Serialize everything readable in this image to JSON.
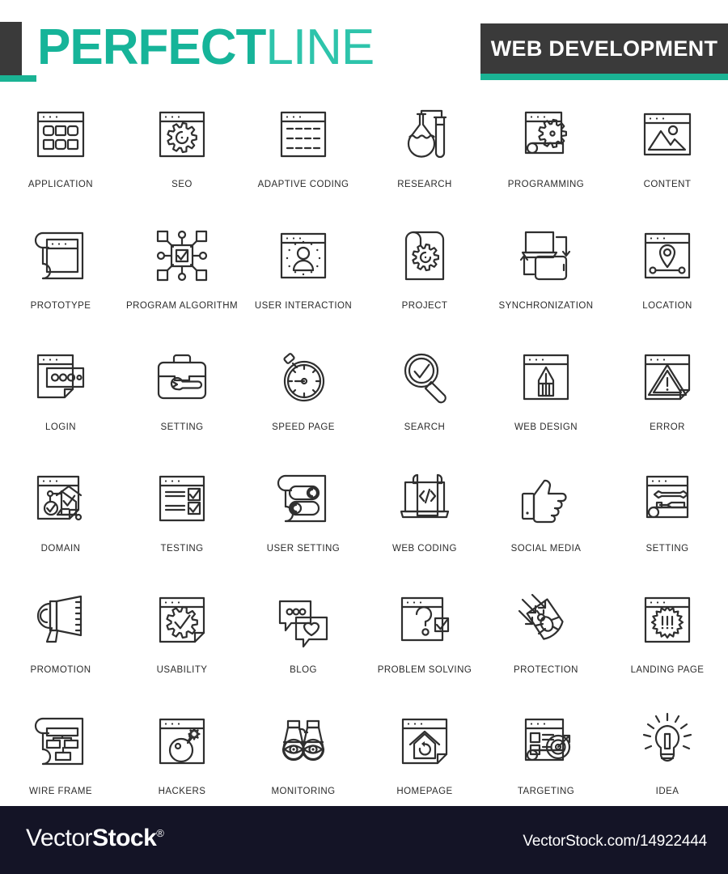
{
  "header": {
    "brand_bold": "PERFECT",
    "brand_light": "LINE",
    "badge_label": "WEB DEVELOPMENT",
    "accent_color": "#1ab394",
    "dark_color": "#3a3a3a"
  },
  "icons": [
    {
      "label": "APPLICATION",
      "icon": "browser-grid-icon"
    },
    {
      "label": "SEO",
      "icon": "browser-gear-icon"
    },
    {
      "label": "ADAPTIVE CODING",
      "icon": "browser-dashed-lines-icon"
    },
    {
      "label": "RESEARCH",
      "icon": "flask-test-tube-icon"
    },
    {
      "label": "PROGRAMMING",
      "icon": "page-gear-icon"
    },
    {
      "label": "CONTENT",
      "icon": "browser-image-icon"
    },
    {
      "label": "PROTOTYPE",
      "icon": "blueprint-roll-browser-icon"
    },
    {
      "label": "PROGRAM ALGORITHM",
      "icon": "chip-network-check-icon"
    },
    {
      "label": "USER INTERACTION",
      "icon": "browser-user-dots-icon"
    },
    {
      "label": "PROJECT",
      "icon": "scroll-gear-icon"
    },
    {
      "label": "SYNCHRONIZATION",
      "icon": "laptop-phone-sync-icon"
    },
    {
      "label": "LOCATION",
      "icon": "browser-map-pin-icon"
    },
    {
      "label": "LOGIN",
      "icon": "page-password-dots-icon"
    },
    {
      "label": "SETTING",
      "icon": "toolbox-wrench-icon"
    },
    {
      "label": "SPEED PAGE",
      "icon": "stopwatch-icon"
    },
    {
      "label": "SEARCH",
      "icon": "magnifier-check-icon"
    },
    {
      "label": "WEB DESIGN",
      "icon": "browser-pencil-icon"
    },
    {
      "label": "ERROR",
      "icon": "browser-warning-triangle-icon"
    },
    {
      "label": "DOMAIN",
      "icon": "browser-house-check-nodes-icon"
    },
    {
      "label": "TESTING",
      "icon": "browser-checklist-icon"
    },
    {
      "label": "USER SETTING",
      "icon": "scroll-toggles-icon"
    },
    {
      "label": "WEB CODING",
      "icon": "laptop-code-scroll-icon"
    },
    {
      "label": "SOCIAL MEDIA",
      "icon": "thumbs-up-icon"
    },
    {
      "label": "SETTING",
      "icon": "page-wrench-screwdriver-icon"
    },
    {
      "label": "PROMOTION",
      "icon": "megaphone-icon"
    },
    {
      "label": "USABILITY",
      "icon": "browser-gear-check-icon"
    },
    {
      "label": "BLOG",
      "icon": "chat-bubbles-heart-icon"
    },
    {
      "label": "PROBLEM SOLVING",
      "icon": "browser-question-check-icon"
    },
    {
      "label": "PROTECTION",
      "icon": "shield-bug-arrows-icon"
    },
    {
      "label": "LANDING PAGE",
      "icon": "browser-starburst-icon"
    },
    {
      "label": "WIRE FRAME",
      "icon": "blueprint-roll-sitemap-icon"
    },
    {
      "label": "HACKERS",
      "icon": "browser-bomb-icon"
    },
    {
      "label": "MONITORING",
      "icon": "binoculars-eyes-icon"
    },
    {
      "label": "HOMEPAGE",
      "icon": "browser-house-refresh-icon"
    },
    {
      "label": "TARGETING",
      "icon": "page-list-target-icon"
    },
    {
      "label": "IDEA",
      "icon": "lightbulb-icon"
    }
  ],
  "footer": {
    "logo_light": "Vector",
    "logo_bold": "Stock",
    "logo_mark": "®",
    "url": "VectorStock.com/14922444",
    "background": "#141426"
  }
}
